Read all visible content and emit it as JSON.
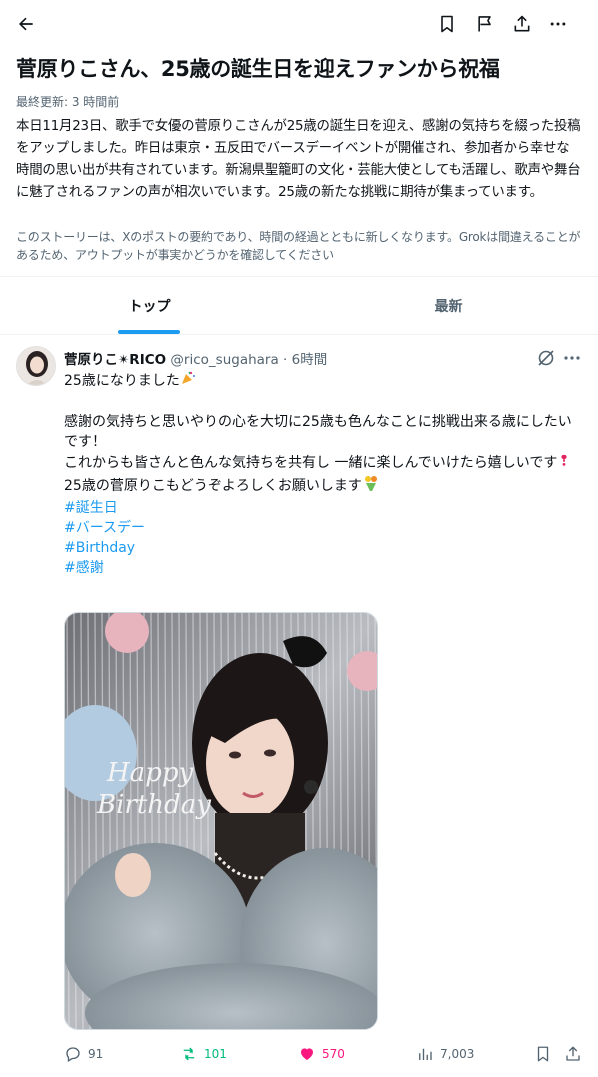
{
  "header": {
    "icons": [
      "back-arrow-icon",
      "bookmark-icon",
      "flag-icon",
      "share-icon",
      "more-icon"
    ]
  },
  "story": {
    "title": "菅原りこさん、25歳の誕生日を迎えファンから祝福",
    "updated": "最終更新: 3 時間前",
    "summary": "本日11月23日、歌手で女優の菅原りこさんが25歳の誕生日を迎え、感謝の気持ちを綴った投稿をアップしました。昨日は東京・五反田でバースデーイベントが開催され、参加者から幸せな時間の思い出が共有されています。新潟県聖籠町の文化・芸能大使としても活躍し、歌声や舞台に魅了されるファンの声が相次いでいます。25歳の新たな挑戦に期待が集まっています。",
    "disclaimer": "このストーリーは、Xのポストの要約であり、時間の経過とともに新しくなります。Grokは間違えることがあるため、アウトプットが事実かどうかを確認してください"
  },
  "tabs": [
    {
      "label": "トップ",
      "active": true
    },
    {
      "label": "最新",
      "active": false
    }
  ],
  "post": {
    "author": "菅原りこ✴︎RICO",
    "handle": "@rico_sugahara · 6時間",
    "line1": "25歳になりました",
    "line2": "感謝の気持ちと思いやりの心を大切に25歳も色んなことに挑戦出来る歳にしたいです！",
    "line3": "これからも皆さんと色んな気持ちを共有し 一緒に楽しんでいけたら嬉しいです",
    "line4": "25歳の菅原りこもどうぞよろしくお願いします",
    "hashtags": [
      "#誕生日",
      "#バースデー",
      "#Birthday",
      "#感謝"
    ],
    "image_text": "Happy Birthday",
    "stats": {
      "replies": "91",
      "reposts": "101",
      "likes": "570",
      "views": "7,003"
    }
  },
  "colors": {
    "accent": "#1d9bf0",
    "repost": "#00ba7c",
    "like": "#f91880",
    "secondary": "#536471"
  }
}
